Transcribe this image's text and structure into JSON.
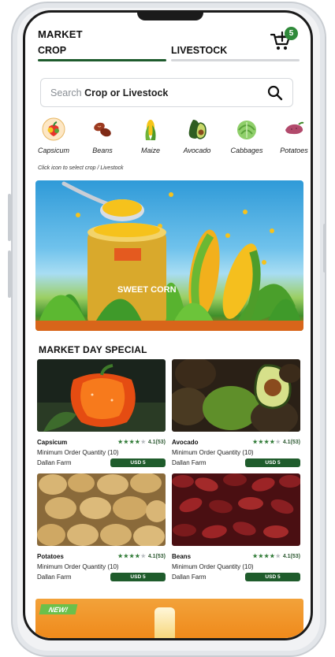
{
  "header": {
    "market_label": "MARKET",
    "tabs": [
      {
        "label": "CROP",
        "active": true
      },
      {
        "label": "LIVESTOCK",
        "active": false
      }
    ],
    "cart_badge": "5"
  },
  "search": {
    "placeholder_prefix": "Search ",
    "placeholder_bold": "Crop or Livestock"
  },
  "categories": {
    "items": [
      {
        "label": "Capsicum",
        "icon": "capsicum-icon"
      },
      {
        "label": "Beans",
        "icon": "beans-icon"
      },
      {
        "label": "Maize",
        "icon": "maize-icon"
      },
      {
        "label": "Avocado",
        "icon": "avocado-icon"
      },
      {
        "label": "Cabbages",
        "icon": "cabbage-icon"
      },
      {
        "label": "Potatoes",
        "icon": "potato-icon"
      }
    ],
    "hint": "Click icon to select crop / Livestock"
  },
  "banner": {
    "subject": "sweet-corn-promo",
    "can_text": "SWEET CORN"
  },
  "market_day_special": {
    "title": "MARKET DAY SPECIAL",
    "products": [
      {
        "name": "Capsicum",
        "rating": "4.1(53)",
        "stars": 4,
        "moq": "Minimum Order Quantity (10)",
        "farm": "Dallan Farm",
        "price": "USD 5"
      },
      {
        "name": "Avocado",
        "rating": "4.1(53)",
        "stars": 4,
        "moq": "Minimum Order Quantity (10)",
        "farm": "Dallan Farm",
        "price": "USD 5"
      },
      {
        "name": "Potatoes",
        "rating": "4.1(53)",
        "stars": 4,
        "moq": "Minimum Order Quantity (10)",
        "farm": "Dallan Farm",
        "price": "USD 5"
      },
      {
        "name": "Beans",
        "rating": "4.1(53)",
        "stars": 4,
        "moq": "Minimum Order Quantity (10)",
        "farm": "Dallan Farm",
        "price": "USD 5"
      }
    ]
  },
  "promo": {
    "tag": "NEW!"
  },
  "colors": {
    "brand_green": "#1f5c2c",
    "badge_green": "#2f8a3a",
    "tab_inactive": "#d5d7da"
  }
}
